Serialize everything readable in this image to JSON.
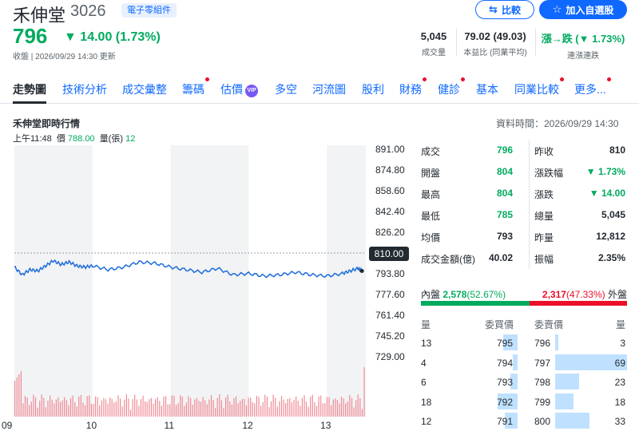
{
  "stock": {
    "name": "禾伸堂",
    "code": "3026",
    "category": "電子零組件",
    "price": "796",
    "change": "14.00",
    "change_pct": "(1.73%)",
    "status": "收盤 | 2026/09/29 14:30 更新"
  },
  "buttons": {
    "compare": "比較",
    "watchlist": "加入自選股"
  },
  "stats": [
    {
      "value": "5,045",
      "label": "成交量"
    },
    {
      "value": "79.02 (49.03)",
      "label": "本益比 (同業平均)"
    },
    {
      "value": "漲→跌 (▼ 1.73%)",
      "label": "連漲連跌"
    }
  ],
  "tabs": [
    "走勢圖",
    "技術分析",
    "成交彙整",
    "籌碼",
    "估價",
    "多空",
    "河流圖",
    "股利",
    "財務",
    "健診",
    "基本",
    "同業比較",
    "更多..."
  ],
  "vip_label": "VIP",
  "chart": {
    "title": "禾伸堂即時行情",
    "data_time": "資料時間：2026/09/29 14:30",
    "cursor_time": "上午11:48",
    "cursor_price_label": "價",
    "cursor_price": "788.00",
    "cursor_vol_label": "量(張)",
    "cursor_vol": "12",
    "ref_price": "810.00"
  },
  "chart_data": {
    "type": "line",
    "y_ticks": [
      "891.00",
      "874.80",
      "858.60",
      "842.40",
      "826.20",
      "810.00",
      "793.80",
      "777.60",
      "761.40",
      "745.20",
      "729.00"
    ],
    "x_ticks": [
      "09",
      "10",
      "11",
      "12",
      "13"
    ],
    "ylim": [
      729,
      891
    ],
    "reference": 810,
    "x": [
      9.0,
      9.1,
      9.2,
      9.3,
      9.4,
      9.5,
      9.6,
      9.7,
      9.8,
      9.9,
      10.0,
      10.2,
      10.4,
      10.6,
      10.8,
      11.0,
      11.2,
      11.4,
      11.6,
      11.8,
      12.0,
      12.2,
      12.4,
      12.6,
      12.8,
      13.0,
      13.2,
      13.3,
      13.4,
      13.45
    ],
    "values": [
      799,
      793,
      797,
      796,
      800,
      804,
      801,
      803,
      800,
      799,
      800,
      797,
      799,
      803,
      802,
      799,
      797,
      795,
      798,
      793,
      794,
      792,
      793,
      795,
      793,
      792,
      794,
      796,
      798,
      796
    ],
    "volume_note": "intraday volume bars"
  },
  "quote": [
    {
      "l1": "成交",
      "v1": "796",
      "c1": "green",
      "l2": "昨收",
      "v2": "810",
      "c2": "black"
    },
    {
      "l1": "開盤",
      "v1": "804",
      "c1": "green",
      "l2": "漲跌幅",
      "v2": "▼ 1.73%",
      "c2": "green"
    },
    {
      "l1": "最高",
      "v1": "804",
      "c1": "green",
      "l2": "漲跌",
      "v2": "▼ 14.00",
      "c2": "green"
    },
    {
      "l1": "最低",
      "v1": "785",
      "c1": "green",
      "l2": "總量",
      "v2": "5,045",
      "c2": "black"
    },
    {
      "l1": "均價",
      "v1": "793",
      "c1": "black",
      "l2": "昨量",
      "v2": "12,812",
      "c2": "black"
    },
    {
      "l1": "成交金額(億)",
      "v1": "40.02",
      "c1": "black",
      "l2": "振幅",
      "v2": "2.35%",
      "c2": "black"
    }
  ],
  "inside_outside": {
    "inside_label": "內盤",
    "inside_value": "2,578",
    "inside_pct": "(52.67%)",
    "outside_value": "2,317",
    "outside_pct": "(47.33%)",
    "outside_label": "外盤",
    "inside_fraction": 0.5267
  },
  "orderbook": {
    "headers": [
      "量",
      "委買價",
      "委賣價",
      "量"
    ],
    "rows": [
      {
        "bid_vol": "13",
        "bid_price": "795",
        "ask_price": "796",
        "ask_vol": "3",
        "bid_frac": 0.19,
        "ask_frac": 0.04
      },
      {
        "bid_vol": "4",
        "bid_price": "794",
        "ask_price": "797",
        "ask_vol": "69",
        "bid_frac": 0.06,
        "ask_frac": 1.0
      },
      {
        "bid_vol": "6",
        "bid_price": "793",
        "ask_price": "798",
        "ask_vol": "23",
        "bid_frac": 0.09,
        "ask_frac": 0.33
      },
      {
        "bid_vol": "18",
        "bid_price": "792",
        "ask_price": "799",
        "ask_vol": "18",
        "bid_frac": 0.26,
        "ask_frac": 0.26
      },
      {
        "bid_vol": "12",
        "bid_price": "791",
        "ask_price": "800",
        "ask_vol": "33",
        "bid_frac": 0.17,
        "ask_frac": 0.48
      }
    ]
  },
  "colors": {
    "accent": "#0f69ff",
    "up": "#00ab5e",
    "down": "#eb0f29",
    "line": "#1e6cdb"
  }
}
